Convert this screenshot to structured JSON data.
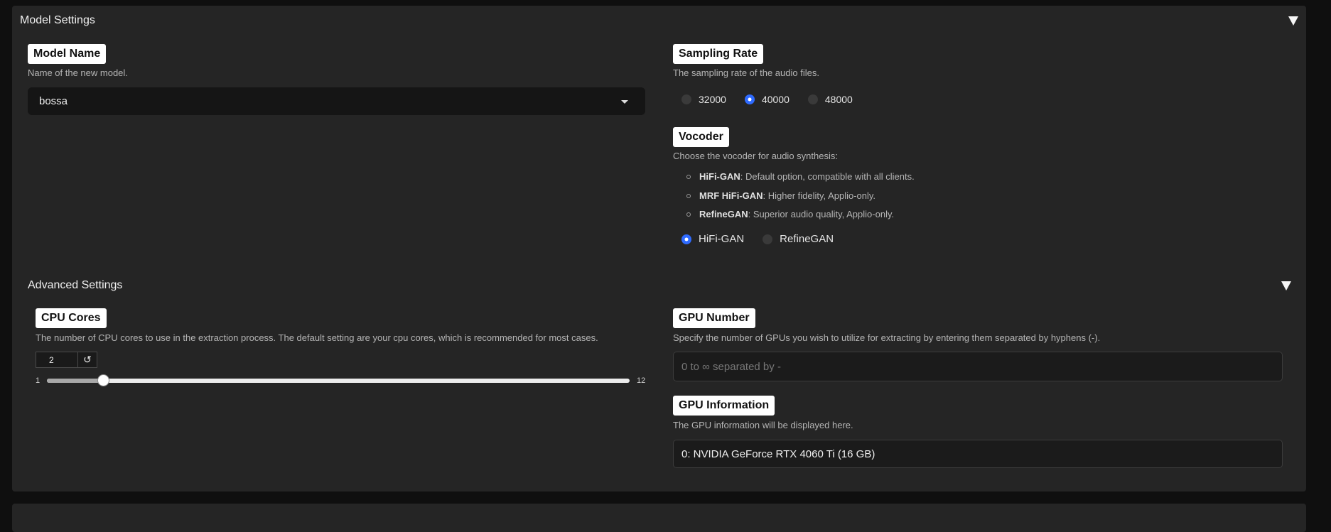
{
  "model_settings": {
    "header": "Model Settings",
    "model_name": {
      "label": "Model Name",
      "description": "Name of the new model.",
      "value": "bossa"
    },
    "sampling_rate": {
      "label": "Sampling Rate",
      "description": "The sampling rate of the audio files.",
      "options": [
        "32000",
        "40000",
        "48000"
      ],
      "selected": "40000"
    },
    "vocoder": {
      "label": "Vocoder",
      "description": "Choose the vocoder for audio synthesis:",
      "items": [
        {
          "name": "HiFi-GAN",
          "text": ": Default option, compatible with all clients."
        },
        {
          "name": "MRF HiFi-GAN",
          "text": ": Higher fidelity, Applio-only."
        },
        {
          "name": "RefineGAN",
          "text": ": Superior audio quality, Applio-only."
        }
      ],
      "options": [
        "HiFi-GAN",
        "RefineGAN"
      ],
      "selected": "HiFi-GAN"
    }
  },
  "advanced_settings": {
    "header": "Advanced Settings",
    "cpu_cores": {
      "label": "CPU Cores",
      "description": "The number of CPU cores to use in the extraction process. The default setting are your cpu cores, which is recommended for most cases.",
      "value": "2",
      "min": "1",
      "max": "12",
      "reset_icon": "↺"
    },
    "gpu_number": {
      "label": "GPU Number",
      "description": "Specify the number of GPUs you wish to utilize for extracting by entering them separated by hyphens (-).",
      "placeholder": "0 to ∞ separated by -"
    },
    "gpu_information": {
      "label": "GPU Information",
      "description": "The GPU information will be displayed here.",
      "value": "0: NVIDIA GeForce RTX 4060 Ti (16 GB)"
    }
  },
  "colors": {
    "accent": "#2f6bff",
    "panel": "#252525",
    "background": "#0f0f0f"
  }
}
